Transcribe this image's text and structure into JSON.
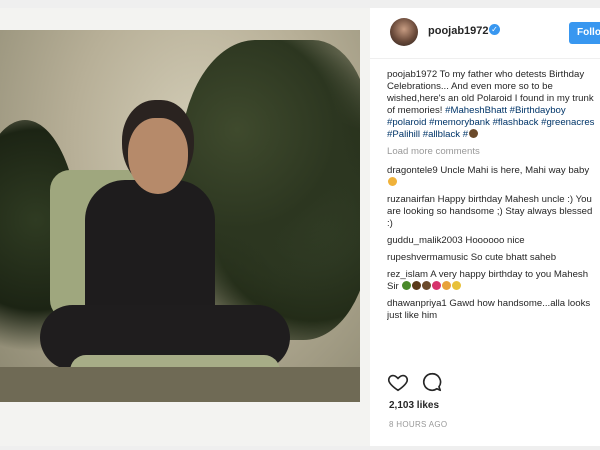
{
  "post": {
    "username": "poojab1972",
    "follow_label": "Follo",
    "caption": {
      "username": "poojab1972",
      "text_before": " To my father who detests Birthday Celebrations... And even more so to be wished,here's an old Polaroid I found in my trunk of memories! ",
      "hashtags_line": "#MaheshBhatt #Birthdayboy #polaroid #memorybank #flashback #greenacres #Palihill #allblack #"
    },
    "load_more_label": "Load more comments",
    "comments": [
      {
        "username": "dragontele9",
        "text": " Uncle Mahi is here, Mahi way baby"
      },
      {
        "username": "ruzanairfan",
        "text": " Happy birthday Mahesh uncle :) You are looking so handsome ;) Stay always blessed :)"
      },
      {
        "username": "guddu_malik2003",
        "text": " Hoooooo nice"
      },
      {
        "username": "rupeshvermamusic",
        "text": " So cute bhatt saheb"
      },
      {
        "username": "rez_islam",
        "text": " A very happy birthday to you Mahesh Sir "
      },
      {
        "username": "dhawanpriya1",
        "text": " Gawd how handsome...alla looks just like him"
      }
    ],
    "likes_label": "2,103 likes",
    "time_label": "8 HOURS AGO"
  },
  "icons": {
    "like": "heart-icon",
    "comment": "comment-icon",
    "verified": "verified-badge-icon"
  },
  "colors": {
    "accent": "#3897f0",
    "hashtag": "#003569",
    "muted": "#999999",
    "text": "#262626"
  }
}
